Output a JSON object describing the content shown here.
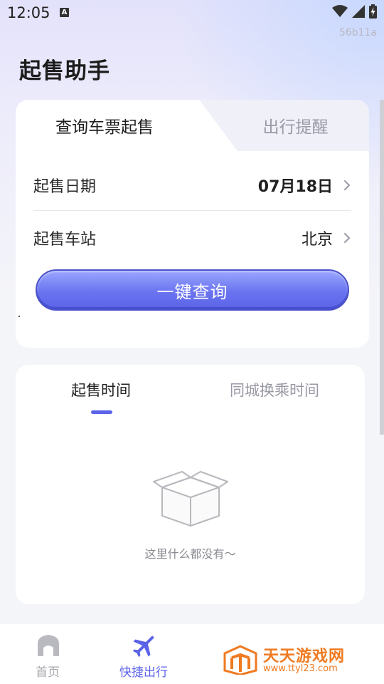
{
  "status_bar": {
    "time": "12:05",
    "a_icon": "A",
    "icons": [
      "notification-a-icon",
      "wifi-icon",
      "signal-icon",
      "battery-charging-icon"
    ]
  },
  "build_id": "56b11a",
  "page": {
    "title": "起售助手"
  },
  "query_card": {
    "tabs": [
      {
        "label": "查询车票起售",
        "active": true
      },
      {
        "label": "出行提醒",
        "active": false
      }
    ],
    "date_row": {
      "label": "起售日期",
      "value": "07月18日"
    },
    "station_row": {
      "label": "起售车站",
      "value": "北京"
    },
    "query_button": "一键查询"
  },
  "time_card": {
    "tabs": [
      {
        "label": "起售时间",
        "active": true
      },
      {
        "label": "同城换乘时间",
        "active": false
      }
    ],
    "empty_text": "这里什么都没有～"
  },
  "bottom_nav": {
    "items": [
      {
        "label": "首页",
        "icon": "home-icon",
        "active": false
      },
      {
        "label": "快捷出行",
        "icon": "airplane-icon",
        "active": true
      }
    ]
  },
  "watermark": {
    "title": "天天游戏网",
    "url": "www.ttyl23.com"
  },
  "colors": {
    "accent": "#5b63e8",
    "watermark": "#f07a20",
    "inactive": "#9a9aa6"
  }
}
